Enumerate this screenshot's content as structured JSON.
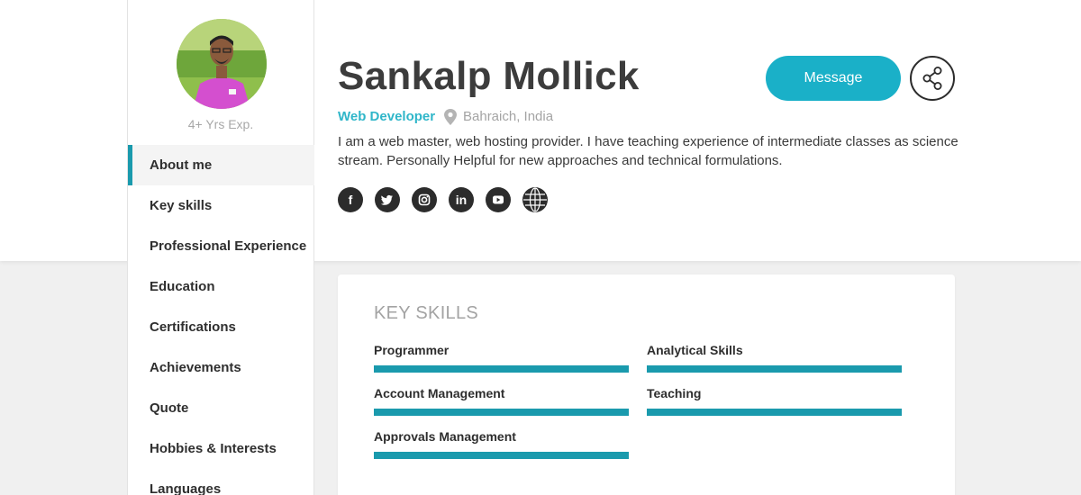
{
  "sidebar": {
    "experience": "4+ Yrs Exp.",
    "nav_items": [
      {
        "label": "About me",
        "active": true
      },
      {
        "label": "Key skills"
      },
      {
        "label": "Professional Experience"
      },
      {
        "label": "Education"
      },
      {
        "label": "Certifications"
      },
      {
        "label": "Achievements"
      },
      {
        "label": "Quote"
      },
      {
        "label": "Hobbies & Interests"
      },
      {
        "label": "Languages"
      }
    ]
  },
  "profile": {
    "name": "Sankalp Mollick",
    "role": "Web Developer",
    "location": "Bahraich, India",
    "bio": "I am a web master, web hosting provider. I have teaching experience of intermediate classes as science stream. Personally Helpful for new approaches and technical formulations.",
    "socials": [
      {
        "icon": "facebook-icon",
        "glyph": "f"
      },
      {
        "icon": "twitter-icon",
        "glyph": ""
      },
      {
        "icon": "instagram-icon",
        "glyph": ""
      },
      {
        "icon": "linkedin-icon",
        "glyph": "in"
      },
      {
        "icon": "youtube-icon",
        "glyph": ""
      },
      {
        "icon": "globe-icon",
        "glyph": ""
      }
    ]
  },
  "actions": {
    "message_label": "Message",
    "share_icon": "share-icon"
  },
  "key_skills": {
    "title": "KEY SKILLS",
    "skills": [
      {
        "label": "Programmer",
        "level": 1.0
      },
      {
        "label": "Analytical Skills",
        "level": 1.0
      },
      {
        "label": "Account Management",
        "level": 1.0
      },
      {
        "label": "Teaching",
        "level": 1.0
      },
      {
        "label": "Approvals Management",
        "level": 1.0
      }
    ]
  },
  "colors": {
    "accent": "#1ab0c8",
    "skill_bar": "#1a9aad",
    "role_text": "#2fb6c9"
  }
}
